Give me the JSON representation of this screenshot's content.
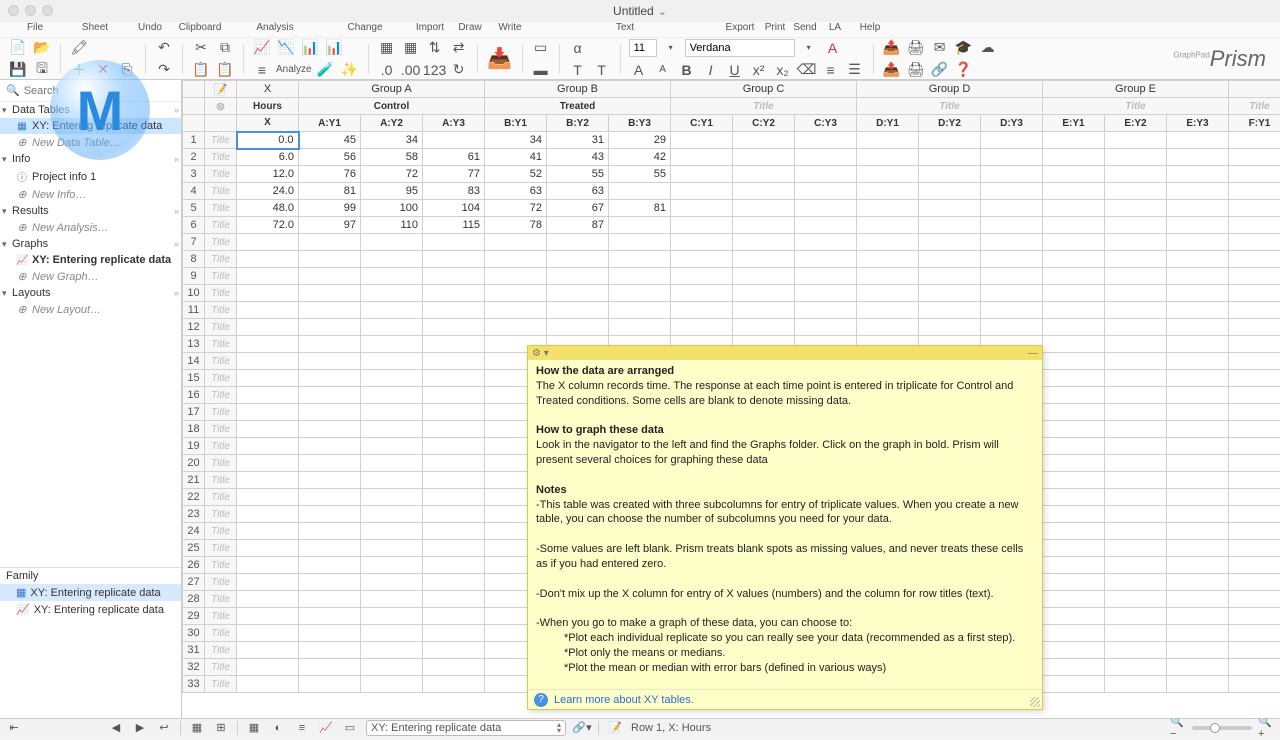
{
  "window": {
    "title": "Untitled"
  },
  "menu": {
    "file": "File",
    "sheet": "Sheet",
    "undo": "Undo",
    "clipboard": "Clipboard",
    "analysis": "Analysis",
    "change": "Change",
    "import": "Import",
    "draw": "Draw",
    "write": "Write",
    "text": "Text",
    "export": "Export",
    "print": "Print",
    "send": "Send",
    "la": "LA",
    "help": "Help"
  },
  "toolbar": {
    "analyze_label": "Analyze",
    "font_size": "11",
    "font_name": "Verdana"
  },
  "brand": {
    "name": "Prism",
    "tag": "GraphPad"
  },
  "nav": {
    "search_placeholder": "Search",
    "sections": {
      "data_tables": "Data Tables",
      "info": "Info",
      "results": "Results",
      "graphs": "Graphs",
      "layouts": "Layouts"
    },
    "data_table_item": "XY: Entering replicate data",
    "new_data_table": "New Data Table…",
    "project_info": "Project info 1",
    "new_info": "New Info…",
    "new_analysis": "New Analysis…",
    "graph_item": "XY: Entering replicate data",
    "new_graph": "New Graph…",
    "new_layout": "New Layout…",
    "family": "Family",
    "family_item_1": "XY: Entering replicate data",
    "family_item_2": "XY: Entering replicate data"
  },
  "grid": {
    "x_label": "X",
    "x_title": "Hours",
    "x_sub": "X",
    "groups": [
      {
        "label": "Group A",
        "title": "Control",
        "subs": [
          "A:Y1",
          "A:Y2",
          "A:Y3"
        ]
      },
      {
        "label": "Group B",
        "title": "Treated",
        "subs": [
          "B:Y1",
          "B:Y2",
          "B:Y3"
        ]
      },
      {
        "label": "Group C",
        "title": "Title",
        "subs": [
          "C:Y1",
          "C:Y2",
          "C:Y3"
        ]
      },
      {
        "label": "Group D",
        "title": "Title",
        "subs": [
          "D:Y1",
          "D:Y2",
          "D:Y3"
        ]
      },
      {
        "label": "Group E",
        "title": "Title",
        "subs": [
          "E:Y1",
          "E:Y2",
          "E:Y3"
        ]
      }
    ],
    "last_sub": "F:Y1",
    "row_title_placeholder": "Title",
    "rows": [
      {
        "n": "1",
        "x": "0.0",
        "a": [
          "45",
          "34",
          ""
        ],
        "b": [
          "34",
          "31",
          "29"
        ]
      },
      {
        "n": "2",
        "x": "6.0",
        "a": [
          "56",
          "58",
          "61"
        ],
        "b": [
          "41",
          "43",
          "42"
        ]
      },
      {
        "n": "3",
        "x": "12.0",
        "a": [
          "76",
          "72",
          "77"
        ],
        "b": [
          "52",
          "55",
          "55"
        ]
      },
      {
        "n": "4",
        "x": "24.0",
        "a": [
          "81",
          "95",
          "83"
        ],
        "b": [
          "63",
          "63",
          ""
        ]
      },
      {
        "n": "5",
        "x": "48.0",
        "a": [
          "99",
          "100",
          "104"
        ],
        "b": [
          "72",
          "67",
          "81"
        ]
      },
      {
        "n": "6",
        "x": "72.0",
        "a": [
          "97",
          "110",
          "115"
        ],
        "b": [
          "78",
          "87",
          ""
        ]
      }
    ],
    "empty_rows": [
      "7",
      "8",
      "9",
      "10",
      "11",
      "12",
      "13",
      "14",
      "15",
      "16",
      "17",
      "18",
      "19",
      "20",
      "21",
      "22",
      "23",
      "24",
      "25",
      "26",
      "27",
      "28",
      "29",
      "30",
      "31",
      "32",
      "33"
    ]
  },
  "note": {
    "h1": "How the data are arranged",
    "p1": "The X column records time. The response at each time point is entered in triplicate for Control and  Treated conditions. Some cells are blank to denote missing data.",
    "h2": "How to graph these data",
    "p2": "Look in the navigator to the left and find the Graphs folder. Click on the graph in bold. Prism will present several choices for graphing these data",
    "h3": "Notes",
    "p3": "-This table was created with three subcolumns for entry of triplicate values. When you create a new table, you can choose the number of subcolumns you need for your data.",
    "p4": "-Some values are left blank. Prism treats blank spots as missing values, and never treats these cells as if you had entered zero.",
    "p5": "-Don't mix up the X column for entry of X values (numbers) and the column for row titles (text).",
    "p6": "-When you go to make a graph of these data, you can choose to:",
    "b1": "*Plot each individual replicate so you can really see your data (recommended as a first step).",
    "b2": "*Plot only the means or medians.",
    "b3": "*Plot the mean or median with error bars (defined in various ways)",
    "learn_more": "Learn more about XY tables."
  },
  "statusbar": {
    "sheet_name": "XY: Entering replicate data",
    "cell_ref": "Row 1, X: Hours"
  }
}
